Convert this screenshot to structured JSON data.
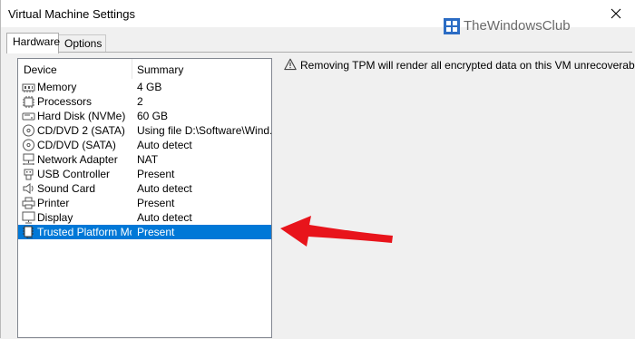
{
  "window": {
    "title": "Virtual Machine Settings"
  },
  "watermark": {
    "text": "TheWindowsClub"
  },
  "tabs": [
    {
      "label": "Hardware",
      "active": true
    },
    {
      "label": "Options",
      "active": false
    }
  ],
  "device_list": {
    "columns": [
      "Device",
      "Summary"
    ],
    "rows": [
      {
        "device": "Memory",
        "summary": "4 GB",
        "icon": "memory-icon"
      },
      {
        "device": "Processors",
        "summary": "2",
        "icon": "processor-icon"
      },
      {
        "device": "Hard Disk (NVMe)",
        "summary": "60 GB",
        "icon": "hard-disk-icon"
      },
      {
        "device": "CD/DVD 2 (SATA)",
        "summary": "Using file D:\\Software\\Wind...",
        "icon": "cd-dvd-icon"
      },
      {
        "device": "CD/DVD (SATA)",
        "summary": "Auto detect",
        "icon": "cd-dvd-icon"
      },
      {
        "device": "Network Adapter",
        "summary": "NAT",
        "icon": "network-adapter-icon"
      },
      {
        "device": "USB Controller",
        "summary": "Present",
        "icon": "usb-icon"
      },
      {
        "device": "Sound Card",
        "summary": "Auto detect",
        "icon": "speaker-icon"
      },
      {
        "device": "Printer",
        "summary": "Present",
        "icon": "printer-icon"
      },
      {
        "device": "Display",
        "summary": "Auto detect",
        "icon": "monitor-icon"
      },
      {
        "device": "Trusted Platform Mo...",
        "summary": "Present",
        "icon": "tpm-chip-icon",
        "selected": true
      }
    ]
  },
  "notice": {
    "icon": "warning-icon",
    "text": "Removing TPM will render all encrypted data on this VM unrecoverable."
  },
  "colors": {
    "selection": "#0078d7",
    "arrow": "#e8141b",
    "watermark_logo": "#2b6cc4"
  }
}
